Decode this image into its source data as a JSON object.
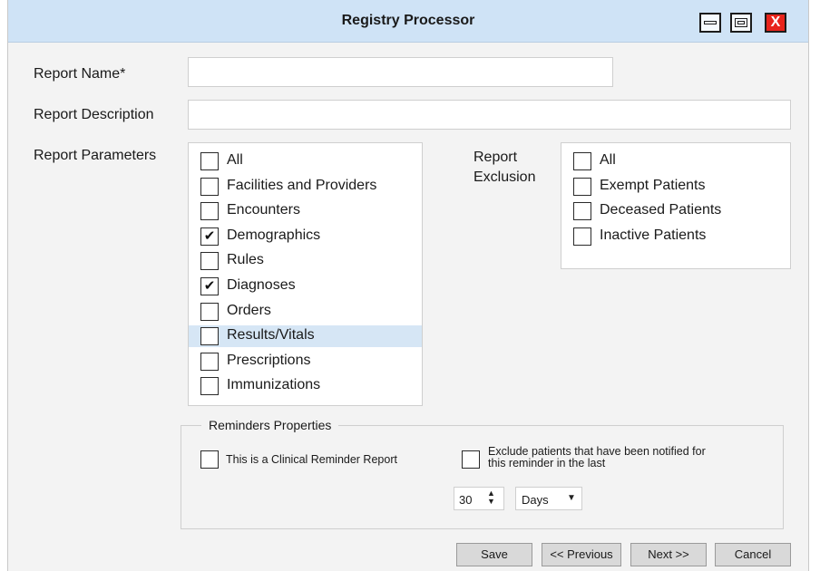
{
  "window": {
    "title": "Registry Processor",
    "close_glyph": "X"
  },
  "form": {
    "report_name_label": "Report Name*",
    "report_name_value": "",
    "report_description_label": "Report Description",
    "report_description_value": "",
    "report_parameters_label": "Report Parameters",
    "report_exclusion_label": "Report Exclusion"
  },
  "parameters": [
    {
      "label": "All",
      "checked": false,
      "highlighted": false
    },
    {
      "label": "Facilities and Providers",
      "checked": false,
      "highlighted": false
    },
    {
      "label": "Encounters",
      "checked": false,
      "highlighted": false
    },
    {
      "label": "Demographics",
      "checked": true,
      "highlighted": false
    },
    {
      "label": "Rules",
      "checked": false,
      "highlighted": false
    },
    {
      "label": "Diagnoses",
      "checked": true,
      "highlighted": false
    },
    {
      "label": "Orders",
      "checked": false,
      "highlighted": false
    },
    {
      "label": "Results/Vitals",
      "checked": false,
      "highlighted": true
    },
    {
      "label": "Prescriptions",
      "checked": false,
      "highlighted": false
    },
    {
      "label": "Immunizations",
      "checked": false,
      "highlighted": false
    }
  ],
  "exclusions": [
    {
      "label": "All",
      "checked": false
    },
    {
      "label": "Exempt Patients",
      "checked": false
    },
    {
      "label": "Deceased Patients",
      "checked": false
    },
    {
      "label": "Inactive Patients",
      "checked": false
    }
  ],
  "reminders": {
    "legend": "Reminders Properties",
    "clinical_reminder_label": "This is a Clinical Reminder Report",
    "clinical_reminder_checked": false,
    "exclude_notified_line1": "Exclude patients that have been notified for",
    "exclude_notified_line2": "this reminder in the last",
    "exclude_notified_checked": false,
    "period_value": "30",
    "period_unit": "Days"
  },
  "buttons": {
    "save": "Save",
    "previous": "<< Previous",
    "next": "Next >>",
    "cancel": "Cancel"
  },
  "colors": {
    "titlebar": "#cfe3f6",
    "highlight_row": "#d6e6f5",
    "close_button": "#e8241c"
  }
}
